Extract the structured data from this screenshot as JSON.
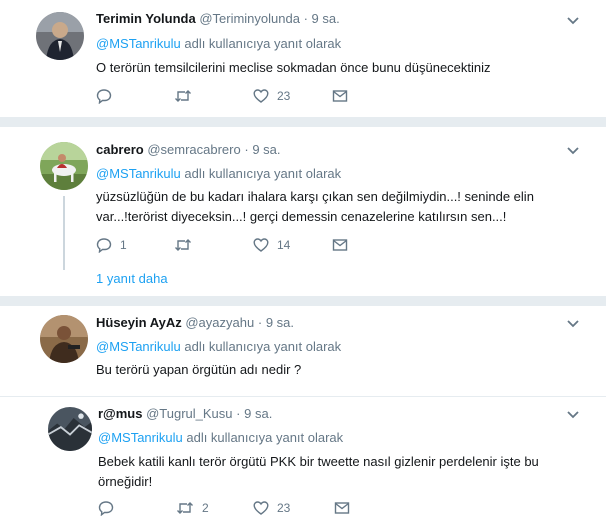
{
  "tweets": [
    {
      "name": "Terimin Yolunda",
      "handle": "@Teriminyolunda",
      "dot": "·",
      "time": "9 sa.",
      "reply_mention": "@MSTanrikulu",
      "reply_suffix": "adlı kullanıcıya yanıt olarak",
      "text": "O terörün temsilcilerini meclise sokmadan önce bunu düşünecektiniz",
      "reply_count": "",
      "retweet_count": "",
      "like_count": "23"
    },
    {
      "name": "cabrero",
      "handle": "@semracabrero",
      "dot": "·",
      "time": "9 sa.",
      "reply_mention": "@MSTanrikulu",
      "reply_suffix": "adlı kullanıcıya yanıt olarak",
      "text_line1": "yüzsüzlüğün de bu kadarı ihalara karşı çıkan sen değilmiydin...! seninde elin",
      "text_line2": "var...!terörist diyeceksin...! gerçi demessin cenazelerine katılırsın sen...!",
      "reply_count": "1",
      "retweet_count": "",
      "like_count": "14",
      "more_replies": "1 yanıt daha"
    },
    {
      "name": "Hüseyin AyAz",
      "handle": "@ayazyahu",
      "dot": "·",
      "time": "9 sa.",
      "reply_mention": "@MSTanrikulu",
      "reply_suffix": "adlı kullanıcıya yanıt olarak",
      "text": "Bu terörü yapan örgütün adı nedir ?"
    },
    {
      "name": "r@mus",
      "handle": "@Tugrul_Kusu",
      "dot": "·",
      "time": "9 sa.",
      "reply_mention": "@MSTanrikulu",
      "reply_suffix": "adlı kullanıcıya yanıt olarak",
      "text_line1": "Bebek katili kanlı terör örgütü PKK bir tweette nasıl gizlenir perdelenir işte bu",
      "text_line2": "örneğidir!",
      "reply_count": "",
      "retweet_count": "2",
      "like_count": "23"
    }
  ],
  "icons": {
    "reply": "reply-icon",
    "retweet": "retweet-icon",
    "like": "heart-icon",
    "dm": "envelope-icon",
    "menu": "chevron-down-icon"
  },
  "colors": {
    "link": "#1da1f2",
    "secondary": "#657786",
    "separator": "#e6ecf0"
  }
}
